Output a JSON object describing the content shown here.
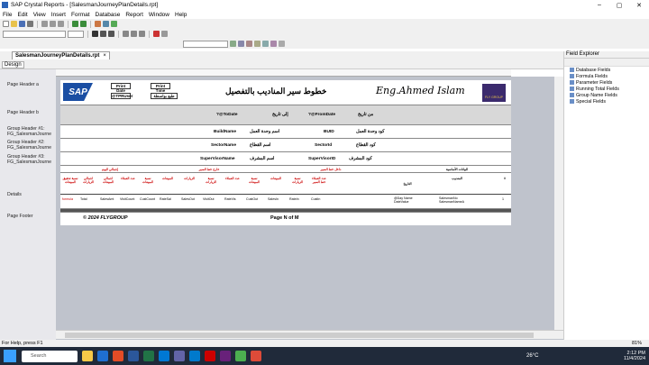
{
  "window": {
    "title": "SAP Crystal Reports - [SalesmanJourneyPlanDetails.rpt]"
  },
  "menu": [
    "File",
    "Edit",
    "View",
    "Insert",
    "Format",
    "Database",
    "Report",
    "Window",
    "Help"
  ],
  "tabs": {
    "design": "Design",
    "report": "SalesmanJourneyPlanDetails.rpt"
  },
  "sections": {
    "page_header_a": "Page Header a",
    "page_header_b": "Page Header b",
    "gh1": "Group Header #1: FG_SalesmanJourne",
    "gh2": "Group Header #2: FG_SalesmanJourne",
    "gh3": "Group Header #3: FG_SalesmanJourne",
    "details": "Details",
    "page_footer": "Page Footer"
  },
  "report": {
    "logo": "SAP",
    "print_date_label": "Print Date",
    "print_time_label": "Print Time",
    "print_date_value": "@TPRUser",
    "print_time_value": "طبع بواسطة",
    "title": "خطوط سير المناديب بالتفصيل",
    "signature": "Eng.Ahmed Islam",
    "company_logo": "FLY GROUP",
    "to_date_field": "?@ToDate",
    "to_date_label": "إلى تاريخ",
    "from_date_field": "?@FromDate",
    "from_date_label": "من تاريخ",
    "g1_name_field": "BuildName",
    "g1_name_label": "اسم وحدة العمل",
    "g1_code_field": "BUID",
    "g1_code_label": "كود وحدة العمل",
    "g2_name_field": "SectorName",
    "g2_name_label": "اسم القطاع",
    "g2_code_field": "SectorId",
    "g2_code_label": "كود القطاع",
    "g3_name_field": "SuperVisorName",
    "g3_name_label": "اسم المشرف",
    "g3_code_field": "SuperVisorID",
    "g3_code_label": "كود المشرف",
    "grp_headers": {
      "total": "إجمالي اليوم",
      "outside": "خارج خط السير",
      "inside": "داخل خط السير",
      "basic": "البيانات الأساسية"
    },
    "col_headers": [
      "نسبة تحقيق المبيعات",
      "اجمالي الزيارات",
      "اجمالي المبيعات",
      "عدد العملاء",
      "نسبة المبيعات",
      "المبيعات",
      "الزيارات",
      "نسبة الزيارات",
      "عدد العملاء",
      "نسبة المبيعات",
      "المبيعات",
      "نسبة الزيارات",
      "عدد العملاء خط السير",
      "التاريخ",
      "المندوب",
      "#"
    ],
    "detail_fields": [
      "formula",
      "Total",
      "SalesAmt",
      "VisitCount",
      "CustCount",
      "RateSal",
      "SalesOut",
      "VisitOut",
      "RateVis",
      "CustOut",
      "SalesIn",
      "RateIn",
      "CustIn",
      "@Day Name DateValue",
      "SalesmanNo SalesmanNameA",
      "1"
    ],
    "footer_copyright": "© 2024 FLYGROUP",
    "footer_page": "Page N of M"
  },
  "field_explorer": {
    "title": "Field Explorer",
    "items": [
      "Database Fields",
      "Formula Fields",
      "Parameter Fields",
      "Running Total Fields",
      "Group Name Fields",
      "Special Fields"
    ]
  },
  "status": {
    "text": "For Help, press F1",
    "zoom": "81%"
  },
  "taskbar": {
    "search": "Search",
    "weather": "26°C",
    "time": "2:12 PM",
    "date": "11/4/2024"
  }
}
